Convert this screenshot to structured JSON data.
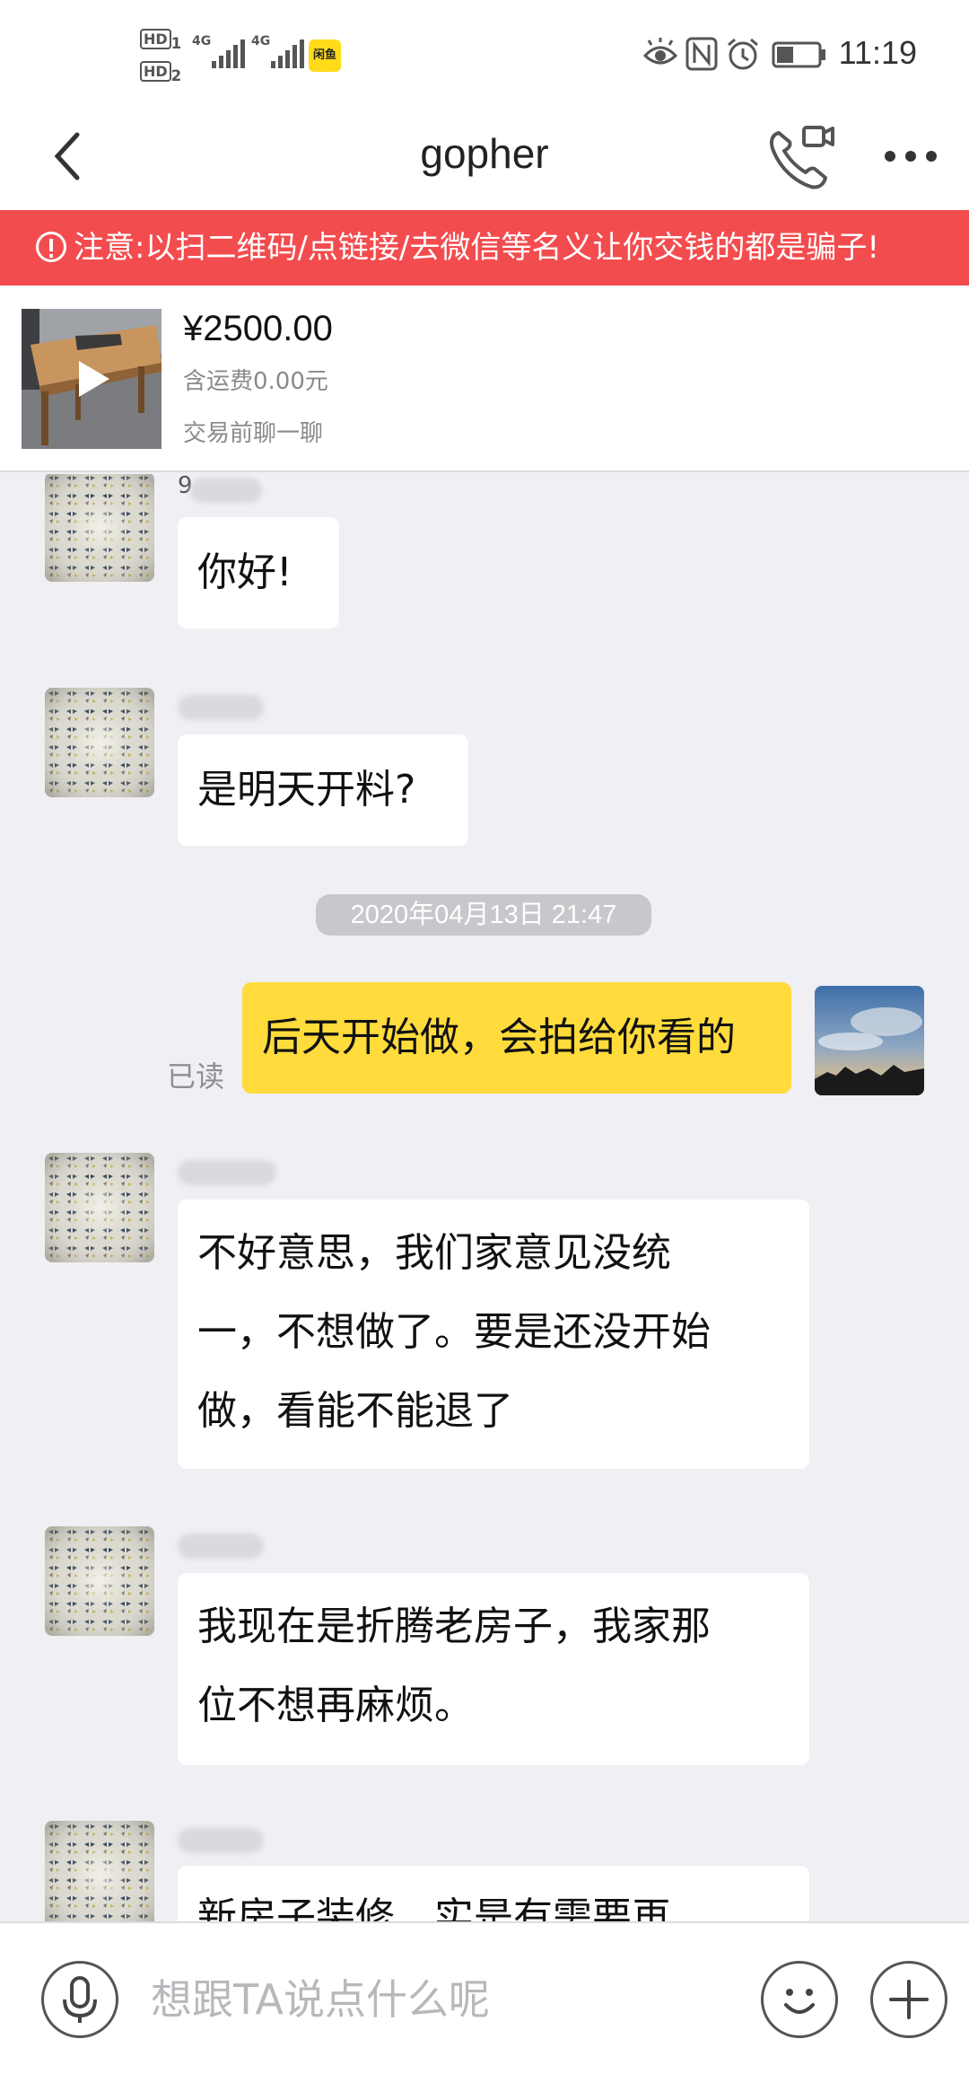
{
  "status_bar": {
    "hd1": "HD",
    "hd1_sub": "1",
    "hd2": "HD",
    "hd2_sub": "2",
    "signal1": "4G",
    "signal2": "4G",
    "app_badge": "闲鱼",
    "time": "11:19",
    "icons": [
      "eye-icon",
      "nfc-icon",
      "alarm-icon",
      "battery-icon"
    ]
  },
  "nav": {
    "title": "gopher",
    "back_icon": "chevron-left-icon",
    "call_icon": "video-call-icon",
    "more_icon": "more-dots-icon"
  },
  "warning": {
    "text": "注意:以扫二维码/点链接/去微信等名义让你交钱的都是骗子!",
    "color": "#f34c4f"
  },
  "product": {
    "price": "¥2500.00",
    "shipping": "含运费0.00元",
    "hint": "交易前聊一聊"
  },
  "messages": [
    {
      "sender": "other",
      "name_visible": "9",
      "text": "你好!"
    },
    {
      "sender": "other",
      "name_visible": "",
      "text": "是明天开料?"
    },
    {
      "type": "timestamp",
      "text": "2020年04月13日 21:47"
    },
    {
      "sender": "self",
      "read_label": "已读",
      "text": "后天开始做，会拍给你看的"
    },
    {
      "sender": "other",
      "name_visible": "",
      "lines": [
        "不好意思，我们家意见没统",
        "一，不想做了。要是还没开始",
        "做，看能不能退了"
      ]
    },
    {
      "sender": "other",
      "name_visible": "",
      "lines": [
        "我现在是折腾老房子，我家那",
        "位不想再麻烦。"
      ]
    },
    {
      "sender": "other",
      "name_visible": "",
      "lines": [
        "新房子装修，实是有需要再"
      ]
    }
  ],
  "input": {
    "placeholder": "想跟TA说点什么呢",
    "mic_icon": "microphone-icon",
    "emoji_icon": "smile-icon",
    "plus_icon": "plus-icon"
  },
  "colors": {
    "self_bubble": "#ffdb3c",
    "background": "#efeff4"
  }
}
